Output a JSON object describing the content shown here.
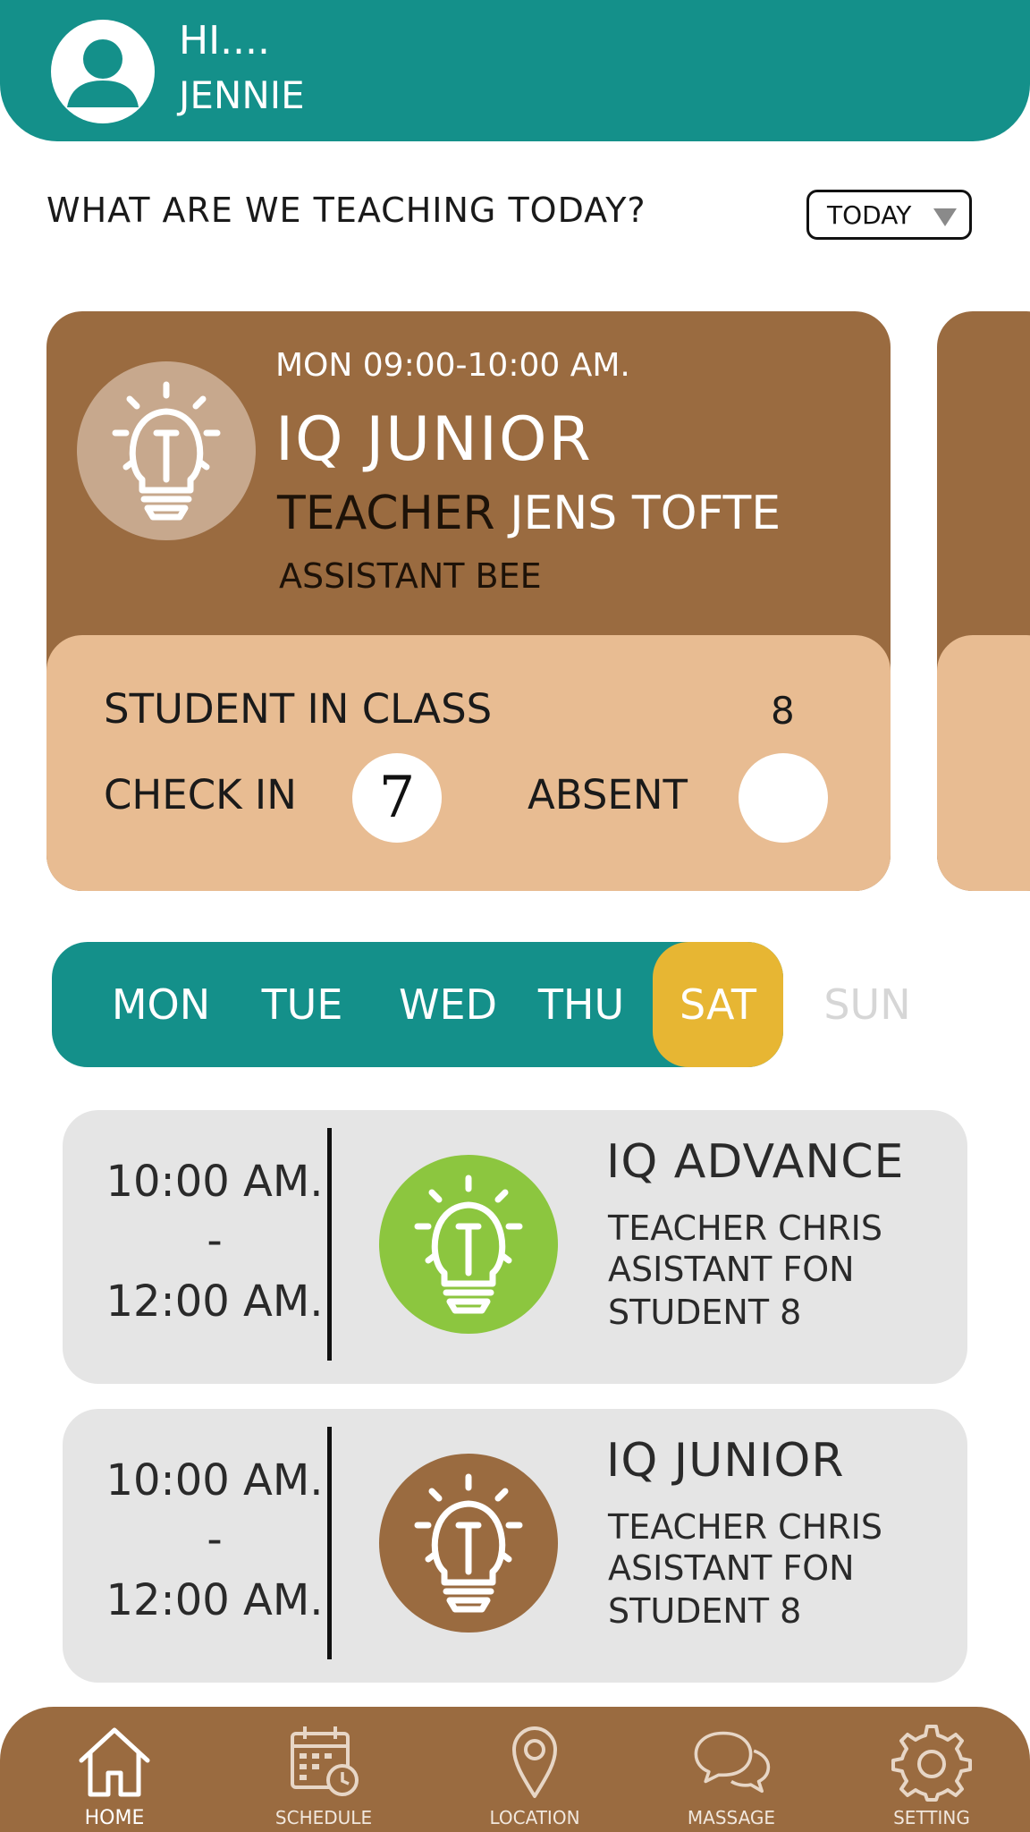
{
  "header": {
    "greeting": "HI....",
    "user_name": "JENNIE"
  },
  "prompt": {
    "question": "WHAT ARE WE TEACHING TODAY?",
    "filter_value": "TODAY"
  },
  "featured_class": {
    "time": "MON 09:00-10:00 AM.",
    "title": "IQ JUNIOR",
    "teacher_label": "TEACHER",
    "teacher_name": "JENS TOFTE",
    "assistant": "ASSISTANT BEE",
    "students_label": "STUDENT IN CLASS",
    "students_count": "8",
    "checkin_label": "CHECK IN",
    "checkin_count": "7",
    "absent_label": "ABSENT",
    "absent_count": ""
  },
  "days": [
    "MON",
    "TUE",
    "WED",
    "THU",
    "SAT",
    "SUN"
  ],
  "active_day": "SAT",
  "lessons": [
    {
      "start": "10:00 AM.",
      "sep": "-",
      "end": "12:00 AM.",
      "title": "IQ ADVANCE",
      "teacher": "TEACHER CHRIS",
      "assistant": "ASISTANT FON",
      "students": "STUDENT   8",
      "icon_color": "#8cc63f"
    },
    {
      "start": "10:00 AM.",
      "sep": "-",
      "end": "12:00 AM.",
      "title": "IQ JUNIOR",
      "teacher": "TEACHER CHRIS",
      "assistant": "ASISTANT FON",
      "students": "STUDENT   8",
      "icon_color": "#9a6b40"
    }
  ],
  "nav": [
    {
      "label": "HOME",
      "icon": "home-icon"
    },
    {
      "label": "SCHEDULE",
      "icon": "calendar-icon"
    },
    {
      "label": "LOCATION",
      "icon": "location-pin-icon"
    },
    {
      "label": "MASSAGE",
      "icon": "chat-bubbles-icon"
    },
    {
      "label": "SETTING",
      "icon": "gear-icon"
    }
  ],
  "colors": {
    "teal": "#14908a",
    "brown": "#9a6b40",
    "peach": "#e8bc92",
    "yellow": "#e7b633",
    "green": "#8cc63f"
  }
}
